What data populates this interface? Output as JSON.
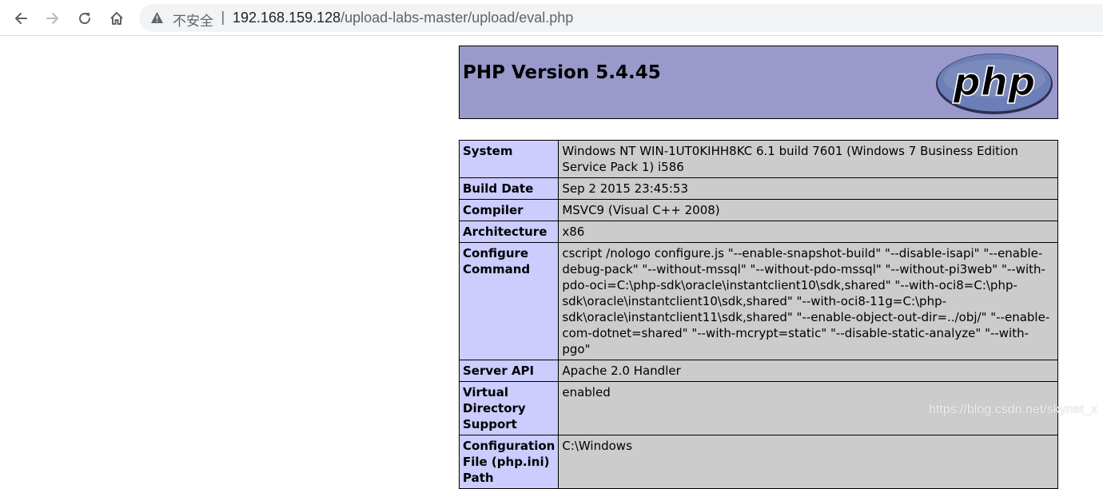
{
  "browser": {
    "security_label": "不安全",
    "separator": "|",
    "url_host": "192.168.159.128",
    "url_path": "/upload-labs-master/upload/eval.php",
    "icons": [
      "back-arrow-icon",
      "forward-arrow-icon",
      "reload-icon",
      "home-icon",
      "warning-icon"
    ]
  },
  "phpinfo": {
    "title": "PHP Version 5.4.45",
    "logo_text": "php",
    "rows": [
      {
        "key": "System",
        "value": "Windows NT WIN-1UT0KIHH8KC 6.1 build 7601 (Windows 7 Business Edition Service Pack 1) i586"
      },
      {
        "key": "Build Date",
        "value": "Sep 2 2015 23:45:53"
      },
      {
        "key": "Compiler",
        "value": "MSVC9 (Visual C++ 2008)"
      },
      {
        "key": "Architecture",
        "value": "x86"
      },
      {
        "key": "Configure Command",
        "value": "cscript /nologo configure.js \"--enable-snapshot-build\" \"--disable-isapi\" \"--enable-debug-pack\" \"--without-mssql\" \"--without-pdo-mssql\" \"--without-pi3web\" \"--with-pdo-oci=C:\\php-sdk\\oracle\\instantclient10\\sdk,shared\" \"--with-oci8=C:\\php-sdk\\oracle\\instantclient10\\sdk,shared\" \"--with-oci8-11g=C:\\php-sdk\\oracle\\instantclient11\\sdk,shared\" \"--enable-object-out-dir=../obj/\" \"--enable-com-dotnet=shared\" \"--with-mcrypt=static\" \"--disable-static-analyze\" \"--with-pgo\""
      },
      {
        "key": "Server API",
        "value": "Apache 2.0 Handler"
      },
      {
        "key": "Virtual Directory Support",
        "value": "enabled"
      },
      {
        "key": "Configuration File (php.ini) Path",
        "value": "C:\\Windows"
      }
    ]
  },
  "watermark": "https://blog.csdn.net/skynet_x",
  "colors": {
    "header_bg": "#9999cc",
    "key_bg": "#ccccff",
    "value_bg": "#cccccc",
    "logo_bg": "#6c7eb7"
  }
}
